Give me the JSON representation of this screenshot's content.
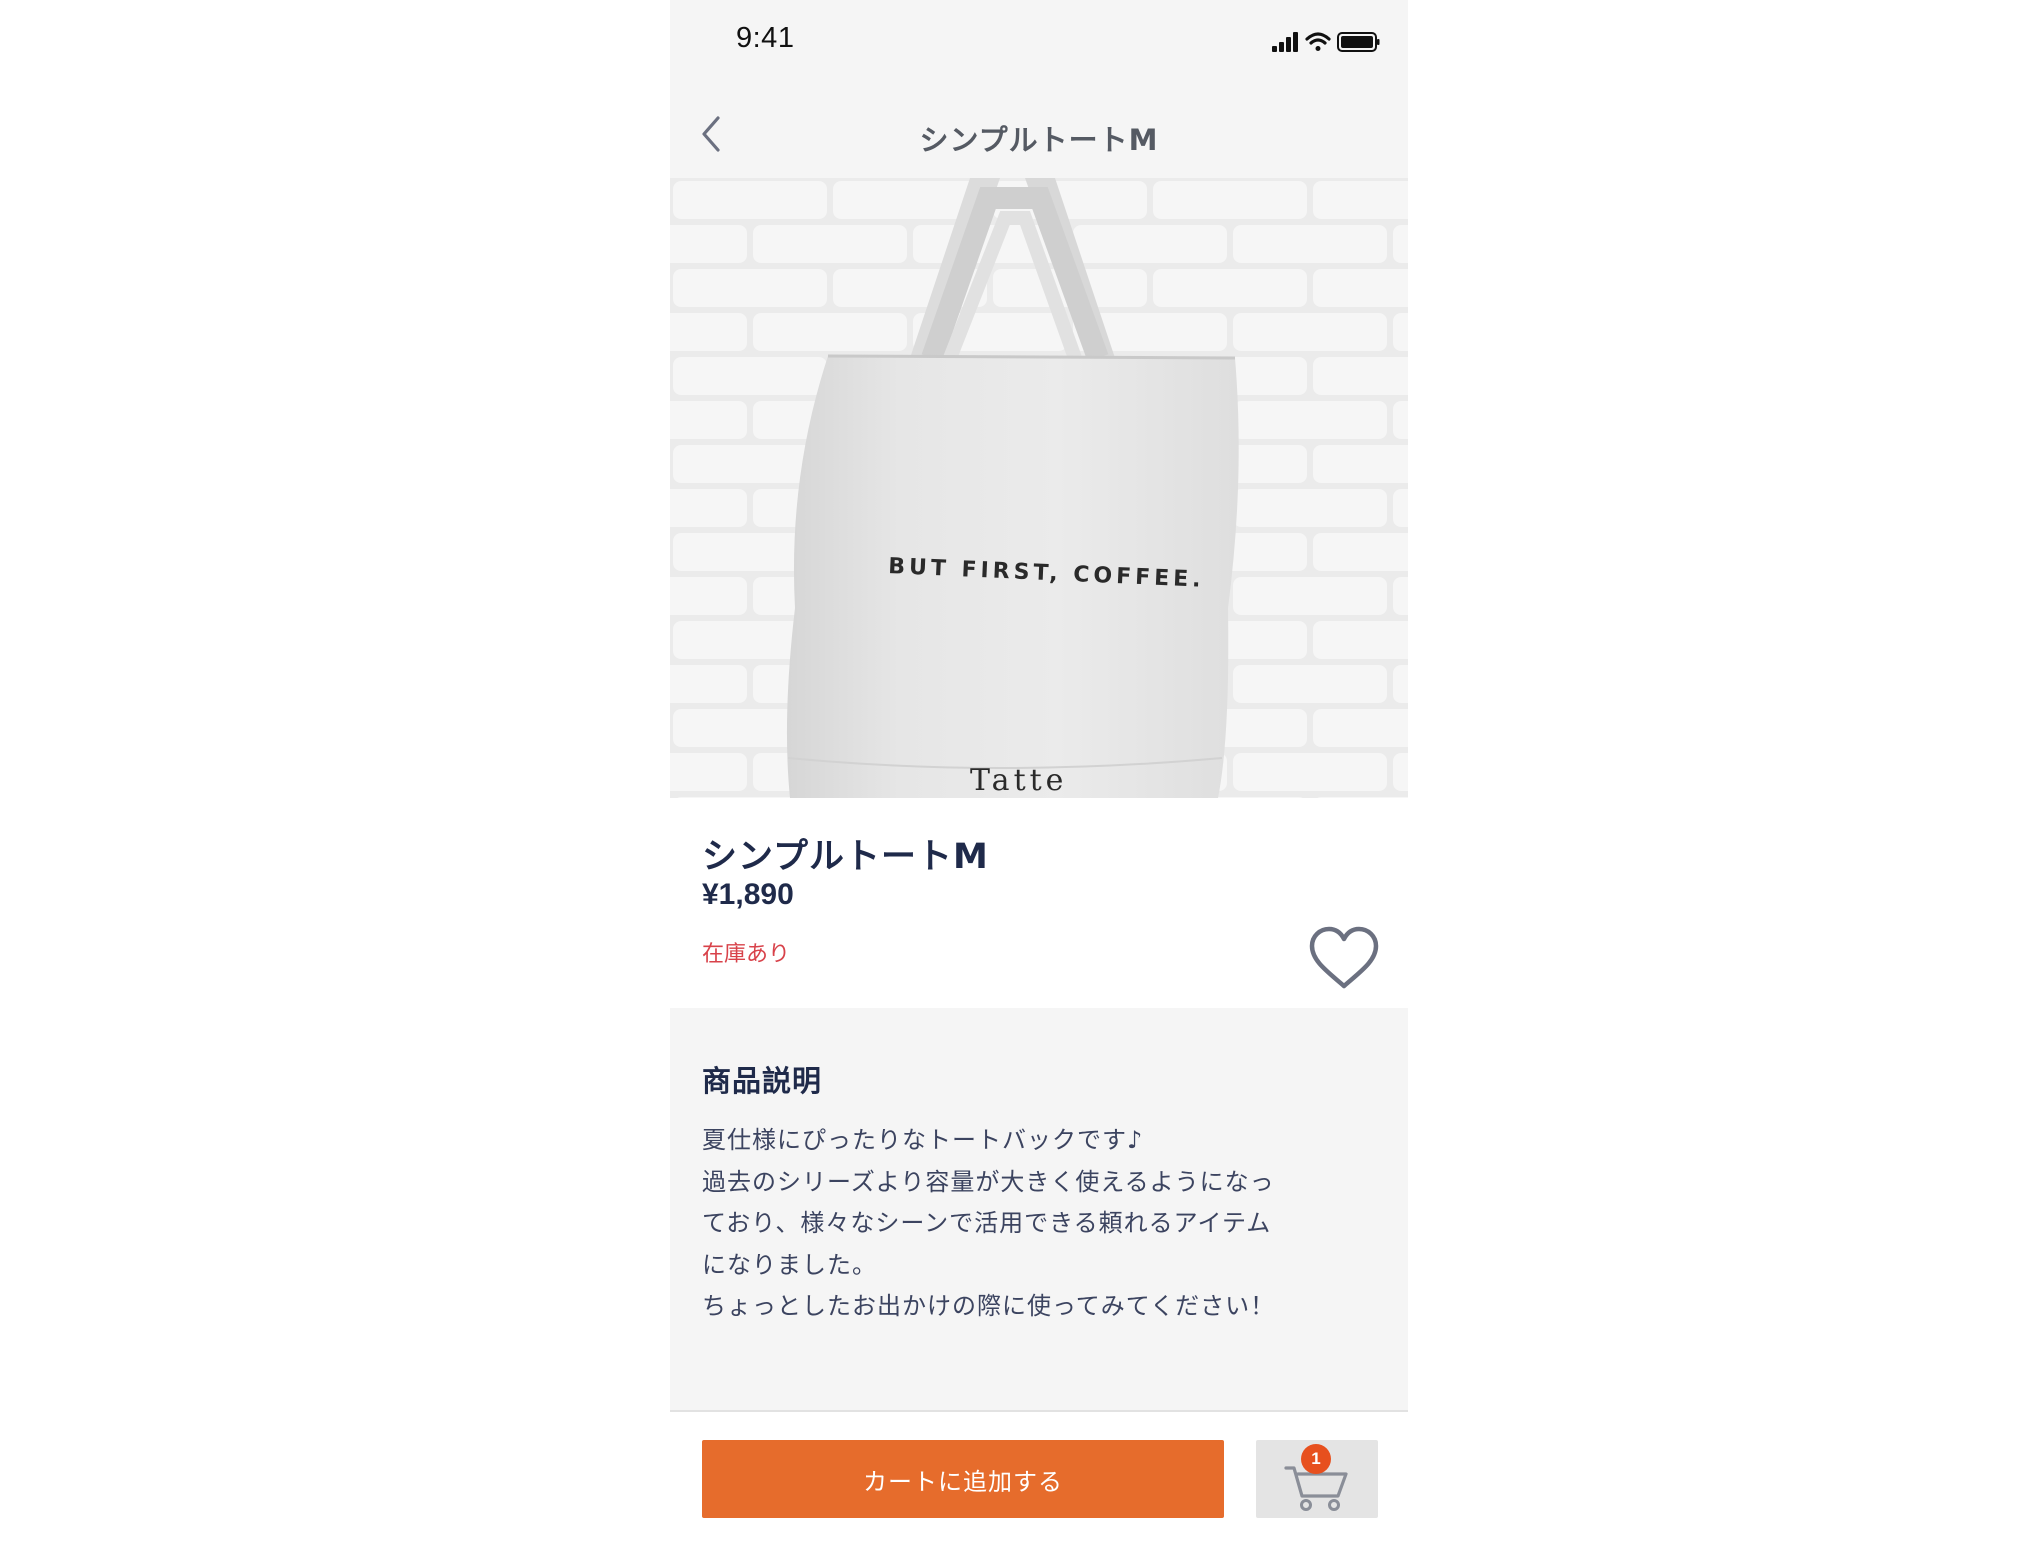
{
  "status_bar": {
    "time": "9:41",
    "icons": [
      "signal-icon",
      "wifi-icon",
      "battery-icon"
    ]
  },
  "nav": {
    "title": "シンプルトートM",
    "back_icon": "chevron-left-icon"
  },
  "product_image": {
    "bag_print_text": "BUT FIRST, COFFEE.",
    "brand_text": "Tatte"
  },
  "product": {
    "name": "シンプルトートM",
    "price": "¥1,890",
    "stock": "在庫あり",
    "favorite_icon": "heart-icon"
  },
  "description": {
    "heading": "商品説明",
    "lines": [
      "夏仕様にぴったりなトートバックです♪",
      "過去のシリーズより容量が大きく使えるようになっ",
      "ており、様々なシーンで活用できる頼れるアイテム",
      "になりました。",
      "ちょっとしたお出かけの際に使ってみてください！"
    ]
  },
  "bottom_bar": {
    "add_to_cart_label": "カートに追加する",
    "cart_icon": "cart-icon",
    "cart_count": "1"
  },
  "colors": {
    "accent": "#e66c2c",
    "badge": "#e7501e",
    "stock": "#d8424a",
    "text_primary": "#1f2a4a",
    "background_gray": "#f5f5f5"
  }
}
